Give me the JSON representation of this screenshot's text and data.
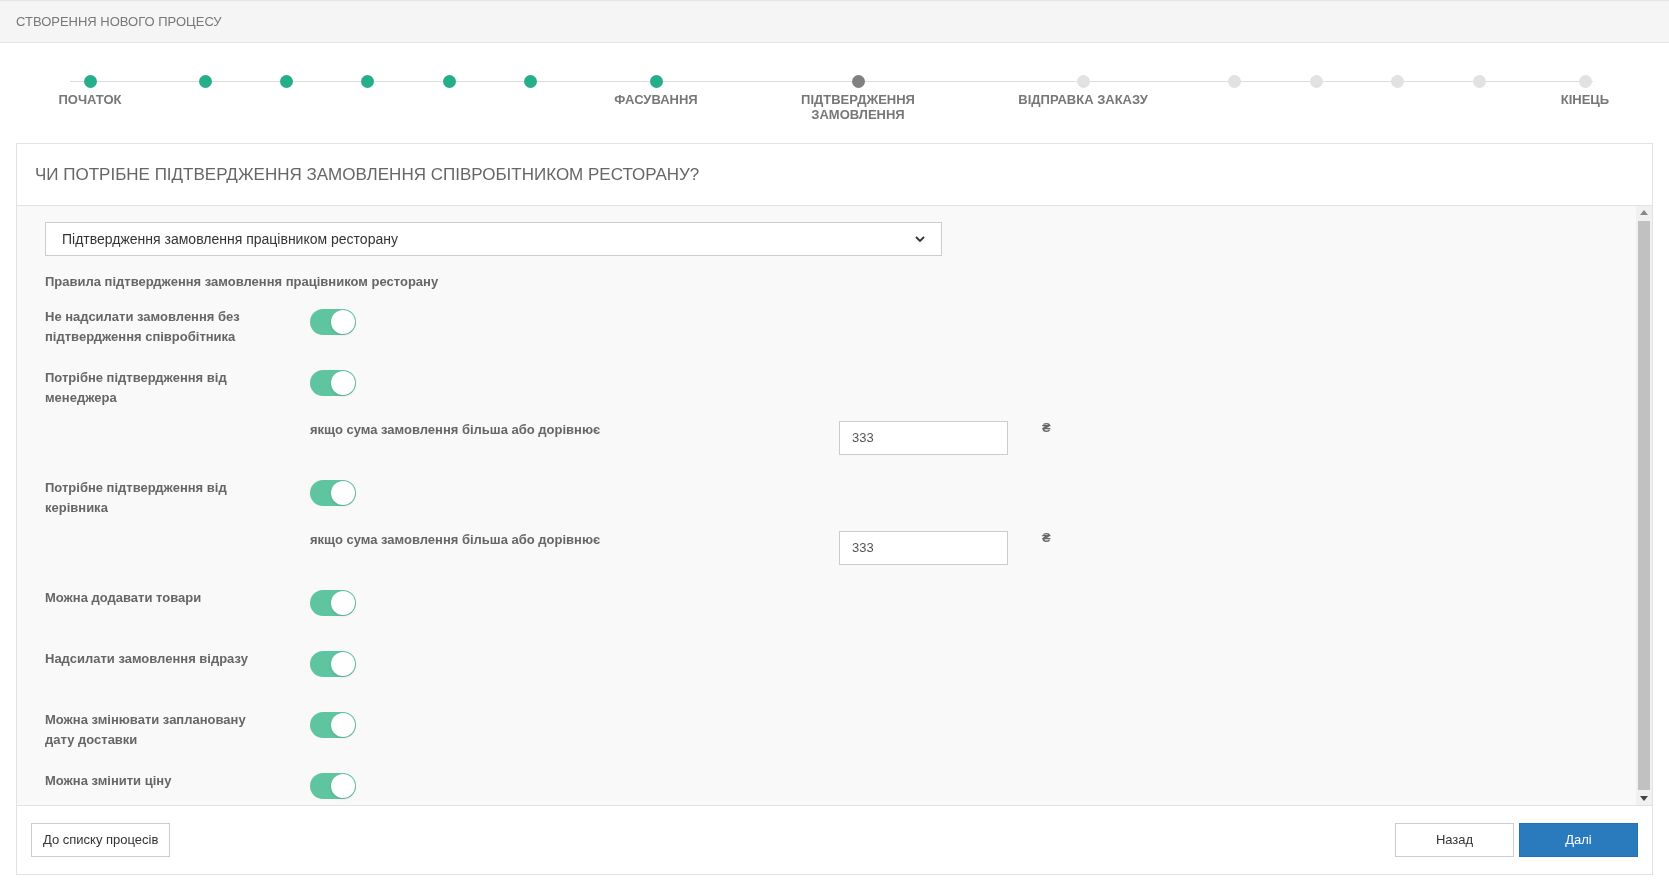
{
  "header": {
    "title": "СТВОРЕННЯ НОВОГО ПРОЦЕСУ"
  },
  "steps": [
    {
      "label": "ПОЧАТОК",
      "done": true,
      "current": false
    },
    {
      "done": true,
      "current": false
    },
    {
      "done": true,
      "current": false
    },
    {
      "done": true,
      "current": false
    },
    {
      "done": true,
      "current": false
    },
    {
      "done": true,
      "current": false
    },
    {
      "label": "ФАСУВАННЯ",
      "done": true,
      "current": false
    },
    {
      "label": "ПІДТВЕРДЖЕННЯ ЗАМОВЛЕННЯ",
      "done": false,
      "current": true
    },
    {
      "label": "ВІДПРАВКА ЗАКАЗУ",
      "done": false,
      "current": false
    },
    {
      "done": false,
      "current": false
    },
    {
      "done": false,
      "current": false
    },
    {
      "done": false,
      "current": false
    },
    {
      "done": false,
      "current": false
    },
    {
      "label": "КІНЕЦЬ",
      "done": false,
      "current": false
    }
  ],
  "question": "ЧИ ПОТРІБНЕ ПІДТВЕРДЖЕННЯ ЗАМОВЛЕННЯ СПІВРОБІТНИКОМ РЕСТОРАНУ?",
  "select": {
    "value": "Підтвердження замовлення працівником ресторану"
  },
  "rules_title": "Правила підтвердження замовлення працівником ресторану",
  "rules": [
    {
      "label": "Не надсилати замовлення без підтвердження співробітника",
      "on": true
    },
    {
      "label": "Потрібне підтвердження від менеджера",
      "on": true,
      "threshold": {
        "label": "якщо сума замовлення більша або дорівнює",
        "value": "333",
        "currency": "₴"
      }
    },
    {
      "label": "Потрібне підтвердження від керівника",
      "on": true,
      "threshold": {
        "label": "якщо сума замовлення більша або дорівнює",
        "value": "333",
        "currency": "₴"
      }
    },
    {
      "label": "Можна додавати товари",
      "on": true
    },
    {
      "label": "Надсилати замовлення відразу",
      "on": true
    },
    {
      "label": "Можна змінювати заплановану дату доставки",
      "on": true
    },
    {
      "label": "Можна змінити ціну",
      "on": true
    }
  ],
  "footer": {
    "list_button": "До списку процесів",
    "back_button": "Назад",
    "next_button": "Далі"
  }
}
